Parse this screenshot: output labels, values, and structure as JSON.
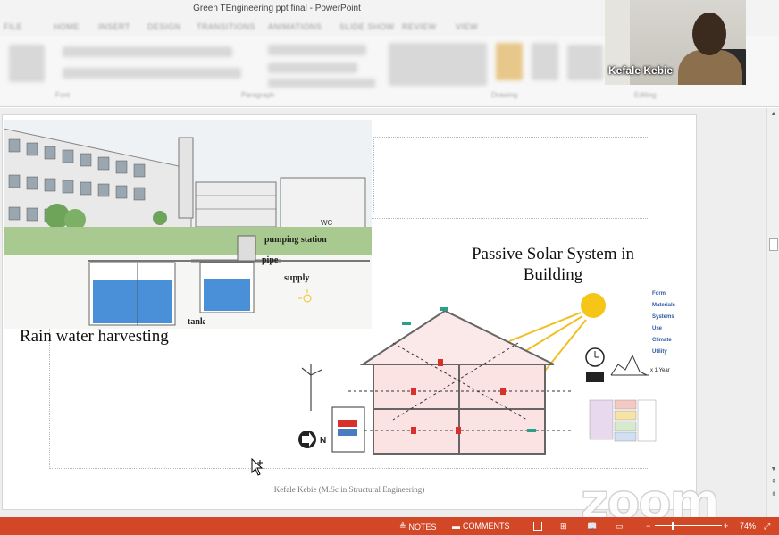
{
  "window": {
    "title": "Green TEngineering ppt final - PowerPoint"
  },
  "ribbon": {
    "tabs": [
      "FILE",
      "HOME",
      "INSERT",
      "DESIGN",
      "TRANSITIONS",
      "ANIMATIONS",
      "SLIDE SHOW",
      "REVIEW",
      "VIEW"
    ],
    "groups": [
      "Font",
      "Paragraph",
      "Drawing",
      "Editing"
    ]
  },
  "video": {
    "participant_name": "Kefale Kebie"
  },
  "slide": {
    "rain_caption": "Rain water harvesting",
    "rain_labels": {
      "pumping": "pumping station",
      "pipe": "pipe",
      "supply": "supply",
      "tank": "tank",
      "wc": "WC"
    },
    "solar_title_line1": "Passive Solar System in",
    "solar_title_line2": "Building",
    "solar_legend": [
      "Form",
      "Materials",
      "Systems",
      "Use",
      "Climate",
      "Utility"
    ],
    "solar_year_label": "x 1 Year",
    "footer": "Kefale Kebie (M.Sc in Structural Engineering)"
  },
  "watermark": "zoom",
  "statusbar": {
    "notes": "NOTES",
    "comments": "COMMENTS",
    "zoom_level": "74%",
    "zoom_minus": "−",
    "zoom_plus": "+",
    "zoom_fraction": 0.27
  },
  "colors": {
    "statusbar": "#d24726",
    "water": "#4a90d9",
    "sun": "#f5c518"
  }
}
